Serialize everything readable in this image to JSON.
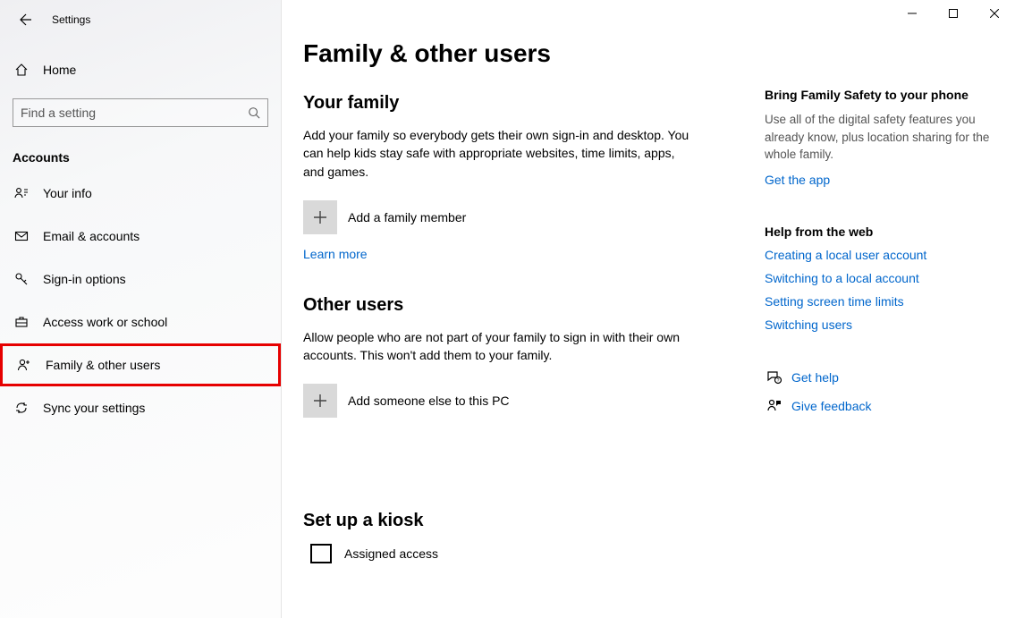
{
  "window": {
    "title": "Settings"
  },
  "sidebar": {
    "home": "Home",
    "search_placeholder": "Find a setting",
    "section": "Accounts",
    "items": [
      {
        "label": "Your info"
      },
      {
        "label": "Email & accounts"
      },
      {
        "label": "Sign-in options"
      },
      {
        "label": "Access work or school"
      },
      {
        "label": "Family & other users"
      },
      {
        "label": "Sync your settings"
      }
    ]
  },
  "page": {
    "title": "Family & other users",
    "family": {
      "heading": "Your family",
      "desc": "Add your family so everybody gets their own sign-in and desktop. You can help kids stay safe with appropriate websites, time limits, apps, and games.",
      "add_label": "Add a family member",
      "learn_more": "Learn more"
    },
    "other": {
      "heading": "Other users",
      "desc": "Allow people who are not part of your family to sign in with their own accounts. This won't add them to your family.",
      "add_label": "Add someone else to this PC"
    },
    "kiosk": {
      "heading": "Set up a kiosk",
      "item": "Assigned access"
    }
  },
  "rail": {
    "promo": {
      "heading": "Bring Family Safety to your phone",
      "desc": "Use all of the digital safety features you already know, plus location sharing for the whole family.",
      "link": "Get the app"
    },
    "help": {
      "heading": "Help from the web",
      "links": [
        "Creating a local user account",
        "Switching to a local account",
        "Setting screen time limits",
        "Switching users"
      ]
    },
    "footer": {
      "get_help": "Get help",
      "feedback": "Give feedback"
    }
  }
}
